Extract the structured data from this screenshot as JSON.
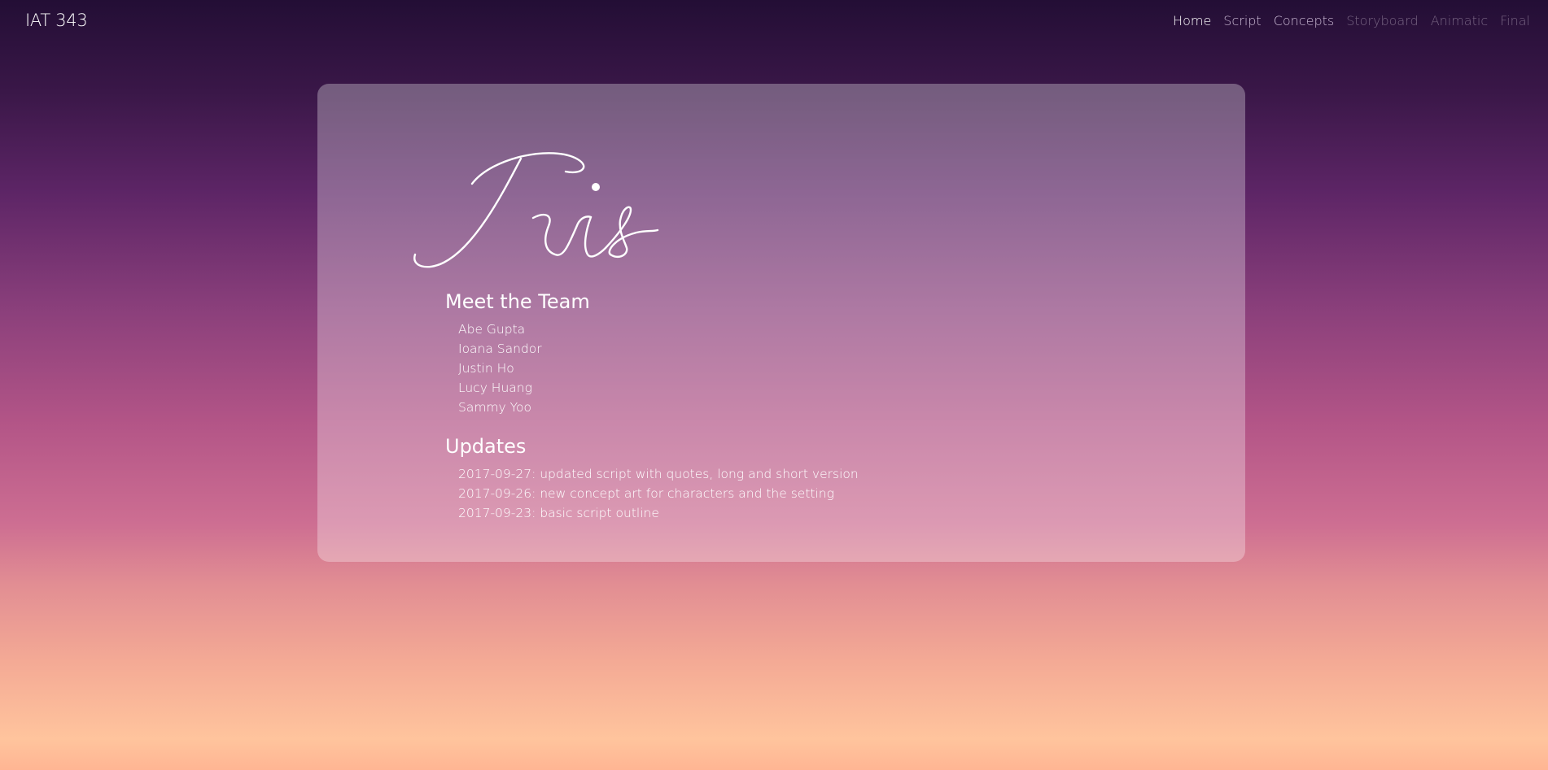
{
  "header": {
    "brand": "IAT 343",
    "nav": [
      {
        "label": "Home",
        "state": "active"
      },
      {
        "label": "Script",
        "state": "normal"
      },
      {
        "label": "Concepts",
        "state": "normal"
      },
      {
        "label": "Storyboard",
        "state": "disabled"
      },
      {
        "label": "Animatic",
        "state": "disabled"
      },
      {
        "label": "Final",
        "state": "disabled"
      }
    ]
  },
  "main": {
    "logo_text": "Iris",
    "team": {
      "title": "Meet the Team",
      "members": [
        "Abe Gupta",
        "Ioana Sandor",
        "Justin Ho",
        "Lucy Huang",
        "Sammy Yoo"
      ]
    },
    "updates": {
      "title": "Updates",
      "items": [
        "2017-09-27: updated script with quotes, long and short version",
        "2017-09-26: new concept art for characters and the setting",
        "2017-09-23: basic script outline"
      ]
    }
  },
  "colors": {
    "nav_active": "#ffffff",
    "nav_normal": "#c8b7d2",
    "nav_disabled": "#776482",
    "card_overlay": "rgba(255,255,255,0.30)"
  }
}
